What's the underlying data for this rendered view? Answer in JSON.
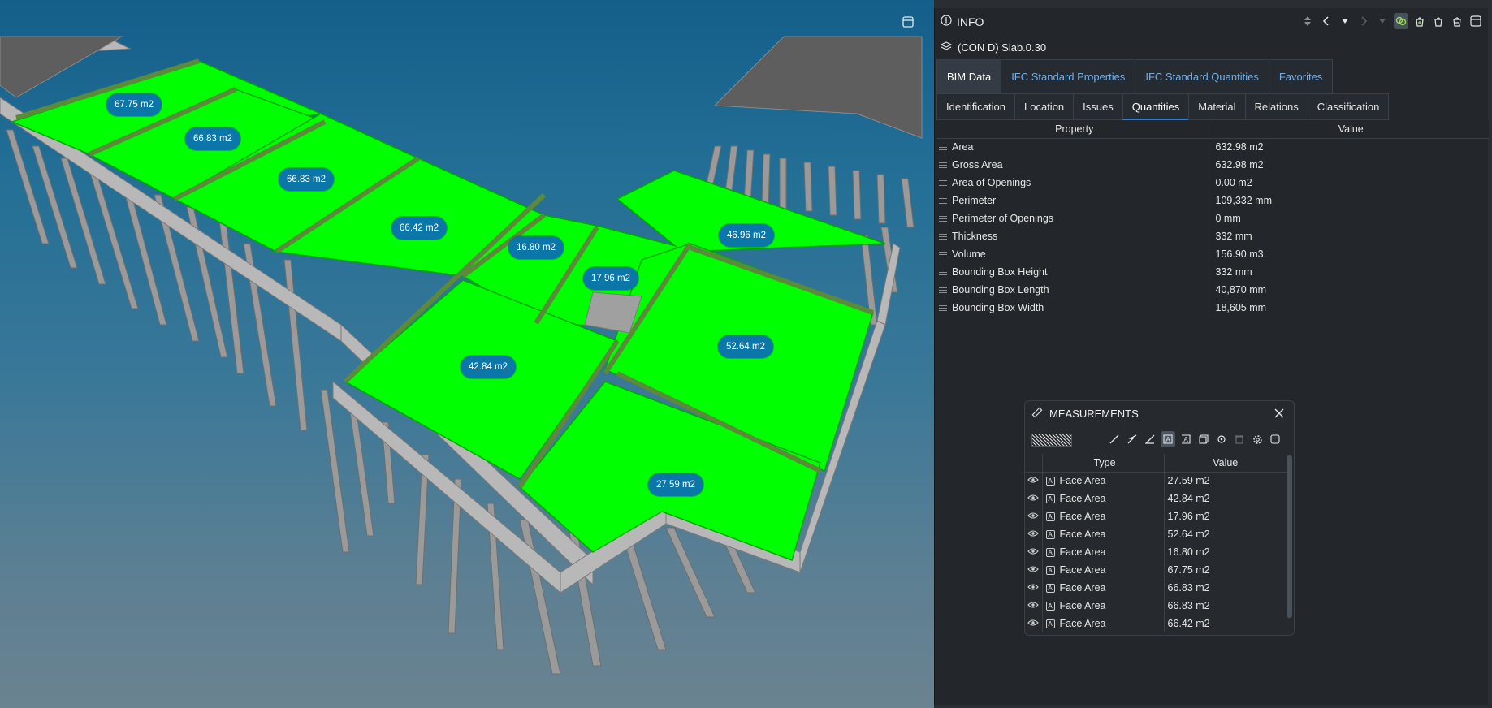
{
  "viewport": {
    "labels": [
      {
        "text": "67.75 m2"
      },
      {
        "text": "66.83 m2"
      },
      {
        "text": "66.83 m2"
      },
      {
        "text": "66.42 m2"
      },
      {
        "text": "16.80 m2"
      },
      {
        "text": "17.96 m2"
      },
      {
        "text": "46.96 m2"
      },
      {
        "text": "52.64 m2"
      },
      {
        "text": "42.84 m2"
      },
      {
        "text": "27.59 m2"
      }
    ],
    "colors": {
      "slab_highlight": "#00ff00",
      "label_bg": "#0b77a8"
    }
  },
  "info_panel": {
    "title": "INFO",
    "object_name": "(CON D) Slab.0.30",
    "main_tabs": [
      {
        "label": "BIM Data"
      },
      {
        "label": "IFC Standard Properties"
      },
      {
        "label": "IFC Standard Quantities"
      },
      {
        "label": "Favorites"
      }
    ],
    "sub_tabs": [
      {
        "label": "Identification"
      },
      {
        "label": "Location"
      },
      {
        "label": "Issues"
      },
      {
        "label": "Quantities"
      },
      {
        "label": "Material"
      },
      {
        "label": "Relations"
      },
      {
        "label": "Classification"
      }
    ],
    "columns": {
      "property": "Property",
      "value": "Value"
    },
    "rows": [
      {
        "property": "Area",
        "value": "632.98 m2"
      },
      {
        "property": "Gross Area",
        "value": "632.98 m2"
      },
      {
        "property": "Area of Openings",
        "value": "0.00 m2"
      },
      {
        "property": "Perimeter",
        "value": "109,332 mm"
      },
      {
        "property": "Perimeter of Openings",
        "value": "0 mm"
      },
      {
        "property": "Thickness",
        "value": "332 mm"
      },
      {
        "property": "Volume",
        "value": "156.90 m3"
      },
      {
        "property": "Bounding Box Height",
        "value": "332 mm"
      },
      {
        "property": "Bounding Box Length",
        "value": "40,870 mm"
      },
      {
        "property": "Bounding Box Width",
        "value": "18,605 mm"
      }
    ],
    "active_main_tab": "BIM Data",
    "active_sub_tab": "Quantities"
  },
  "measurements": {
    "title": "MEASUREMENTS",
    "columns": {
      "type": "Type",
      "value": "Value"
    },
    "rows": [
      {
        "type": "Face Area",
        "value": "27.59 m2"
      },
      {
        "type": "Face Area",
        "value": "42.84 m2"
      },
      {
        "type": "Face Area",
        "value": "17.96 m2"
      },
      {
        "type": "Face Area",
        "value": "52.64 m2"
      },
      {
        "type": "Face Area",
        "value": "16.80 m2"
      },
      {
        "type": "Face Area",
        "value": "67.75 m2"
      },
      {
        "type": "Face Area",
        "value": "66.83 m2"
      },
      {
        "type": "Face Area",
        "value": "66.83 m2"
      },
      {
        "type": "Face Area",
        "value": "66.42 m2"
      }
    ],
    "tools": [
      "line-measure-icon",
      "polyline-measure-icon",
      "angle-measure-icon",
      "face-area-icon",
      "free-area-icon",
      "volume-icon",
      "point-icon",
      "clear-icon",
      "settings-icon",
      "panel-icon"
    ]
  }
}
